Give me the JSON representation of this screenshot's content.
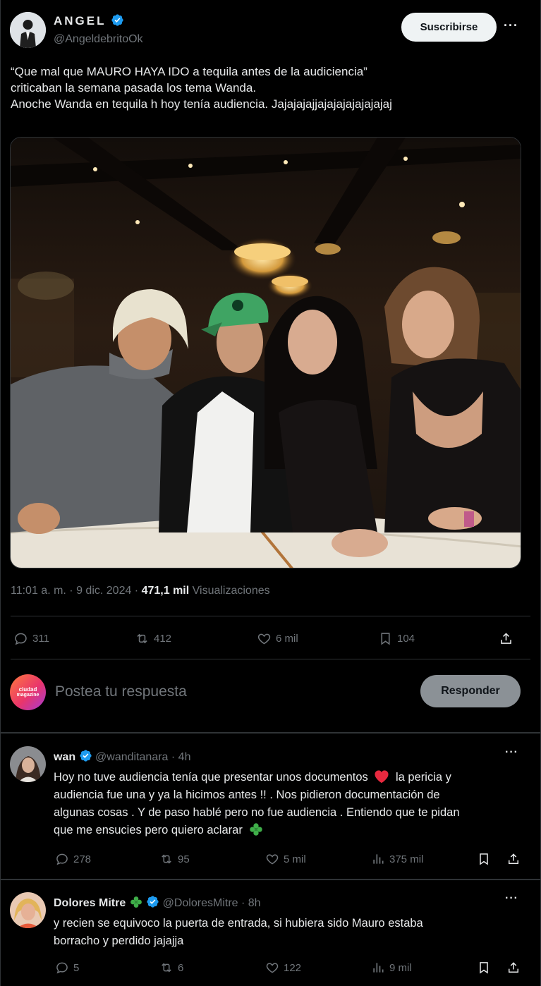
{
  "author": {
    "name": "ANGEL",
    "handle": "@AngeldebritoOk",
    "subscribe_label": "Suscribirse",
    "more": "···"
  },
  "tweet": {
    "line1": "“Que mal que MAURO HAYA IDO  a tequila antes de la audiciencia”",
    "line2": "criticaban la semana pasada los tema Wanda.",
    "line3": "Anoche Wanda en tequila h hoy tenía audiencia. Jajajajajjajajajajajajajaj",
    "time": "11:01 a. m. · 9 dic. 2024 · ",
    "views_count": "471,1 mil",
    "views_label": " Visualizaciones"
  },
  "stats": {
    "replies": "311",
    "reposts": "412",
    "likes": "6 mil",
    "bookmarks": "104"
  },
  "compose": {
    "avatar_text_1": "ciudad",
    "avatar_text_2": "magazine",
    "placeholder": "Postea tu respuesta",
    "reply_label": "Responder"
  },
  "replies": [
    {
      "name": "wan",
      "handle": "@wanditanara",
      "age": "· 4h",
      "line1": "Hoy no tuve audiencia tenía que presentar unos documentos",
      "line1b": "la pericia y",
      "line2": "audiencia fue una y ya la hicimos antes !! . Nos pidieron documentación de",
      "line3": "algunas cosas . Y de paso hablé pero no fue audiencia . Entiendo que te pidan",
      "line4": "que me ensucies pero quiero aclarar",
      "replies": "278",
      "reposts": "95",
      "likes": "5 mil",
      "views": "375 mil",
      "more": "···"
    },
    {
      "name": "Dolores Mitre",
      "handle": "@DoloresMitre",
      "age": "· 8h",
      "line1": "y recien se equivoco la puerta de entrada, si hubiera sido Mauro estaba",
      "line2": "borracho y perdido jajajja",
      "replies": "5",
      "reposts": "6",
      "likes": "122",
      "views": "9 mil",
      "more": "···"
    }
  ],
  "colors": {
    "background": "#000000",
    "verified": "#1d9bf0",
    "muted": "#71767b",
    "heart": "#f91880",
    "clover": "#3fae49"
  }
}
